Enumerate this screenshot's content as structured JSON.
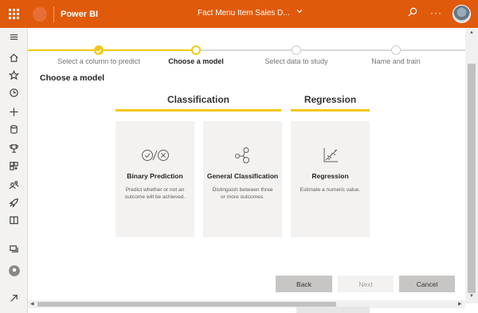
{
  "topbar": {
    "app_name": "Power BI",
    "doc_title": "Fact Menu Item Sales D...",
    "icons": [
      "waffle-icon",
      "powerbi-logo-icon",
      "chevron-down-icon",
      "search-icon",
      "more-icon",
      "avatar"
    ]
  },
  "sidebar": {
    "items": [
      "hamburger-icon",
      "home-icon",
      "star-icon",
      "clock-icon",
      "plus-icon",
      "database-icon",
      "trophy-icon",
      "apps-icon",
      "people-icon",
      "rocket-icon",
      "book-icon",
      "workspaces-icon",
      "my-workspace-icon",
      "expand-icon"
    ]
  },
  "stepper": {
    "steps": [
      {
        "label": "Select a column to predict",
        "state": "done"
      },
      {
        "label": "Choose a model",
        "state": "current"
      },
      {
        "label": "Select data to study",
        "state": "todo"
      },
      {
        "label": "Name and train",
        "state": "todo"
      }
    ]
  },
  "page": {
    "heading": "Choose a model"
  },
  "groups": [
    {
      "title": "Classification"
    },
    {
      "title": "Regression"
    }
  ],
  "cards": [
    {
      "name": "Binary Prediction",
      "desc": "Predict whether or not an outcome will be achieved.",
      "icon": "binary-check-x-icon"
    },
    {
      "name": "General Classification",
      "desc": "Distinguish between three or more outcomes.",
      "icon": "classification-nodes-icon"
    },
    {
      "name": "Regression",
      "desc": "Estimate a numeric value.",
      "icon": "scatter-plot-icon"
    }
  ],
  "buttons": {
    "back": "Back",
    "next": "Next",
    "cancel": "Cancel"
  },
  "colors": {
    "brand": "#e05a0c",
    "accent": "#f2c811",
    "card_bg": "#f3f2f1"
  }
}
